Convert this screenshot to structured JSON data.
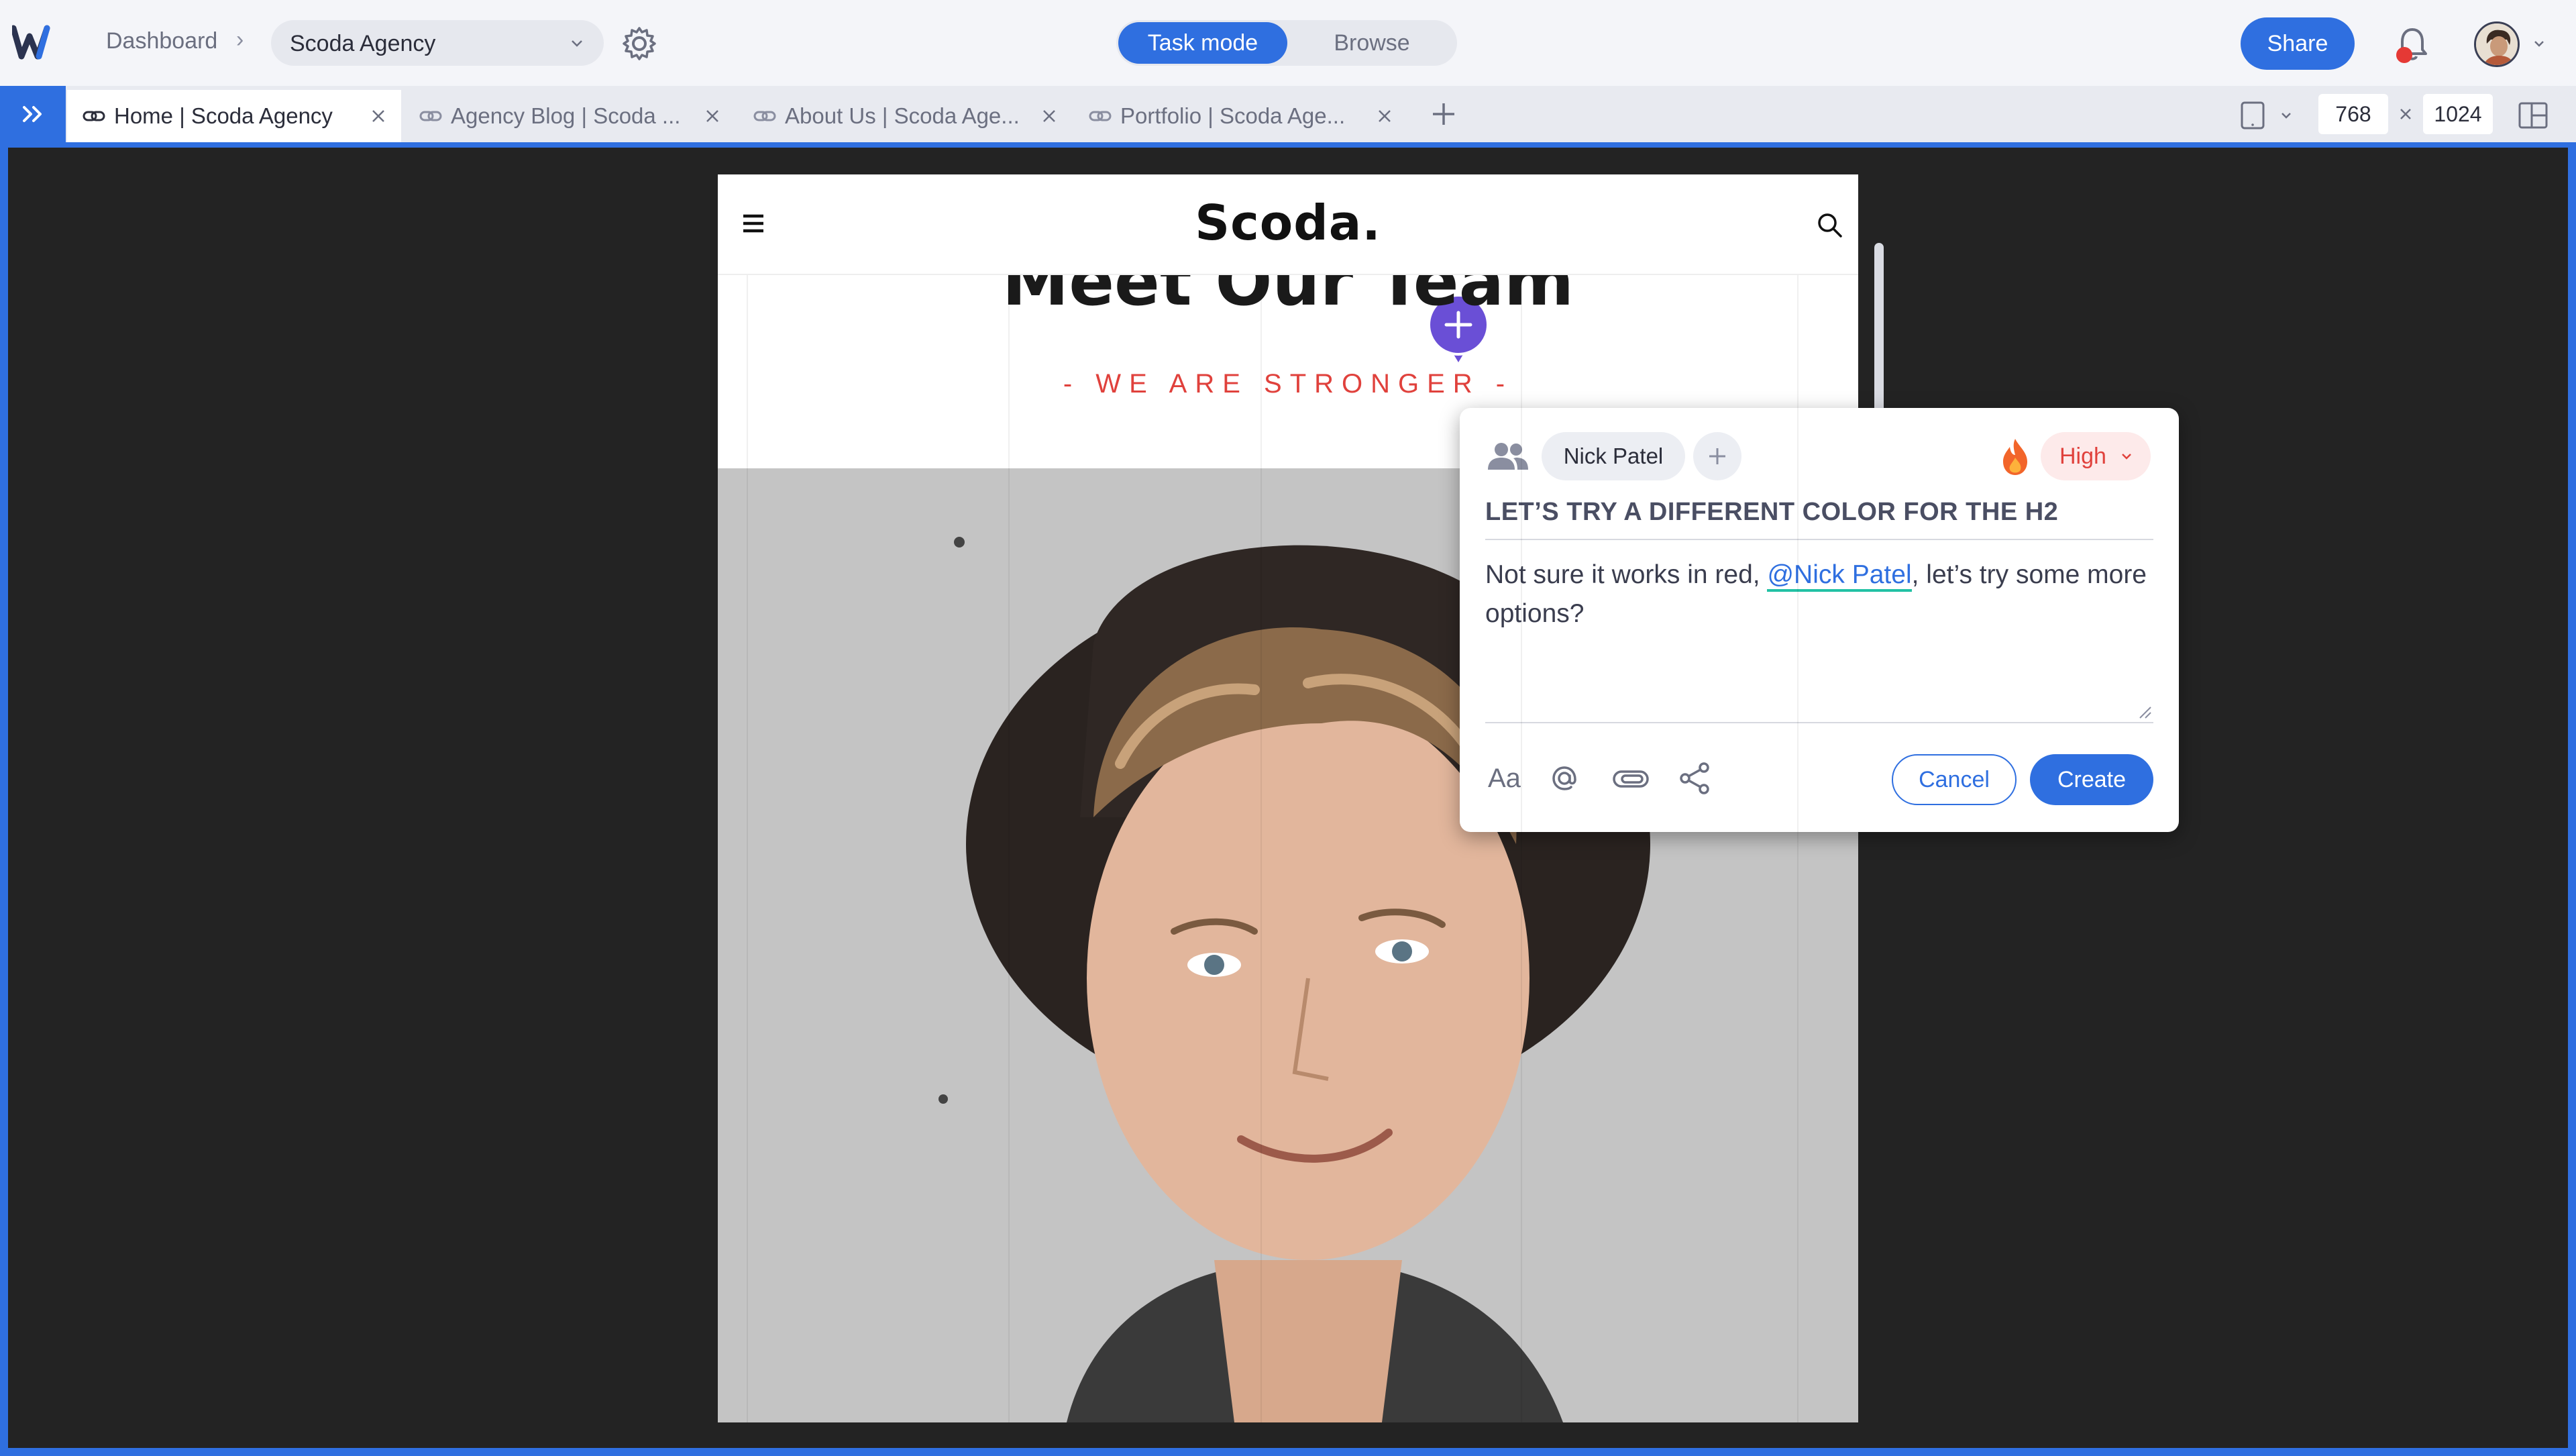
{
  "app": {
    "breadcrumb_root": "Dashboard",
    "project": "Scoda Agency",
    "modes": {
      "task": "Task mode",
      "browse": "Browse",
      "active": "task"
    },
    "share_label": "Share",
    "notification_dot": true
  },
  "tabs": [
    {
      "label": "Home | Scoda Agency",
      "active": true
    },
    {
      "label": "Agency Blog | Scoda ...",
      "active": false
    },
    {
      "label": "About Us | Scoda Age...",
      "active": false
    },
    {
      "label": "Portfolio | Scoda Age...",
      "active": false
    }
  ],
  "viewport": {
    "width": "768",
    "height": "1024"
  },
  "site": {
    "logo": "Scoda.",
    "hero_title": "Meet Our Team",
    "hero_subtitle": "- WE ARE STRONGER -"
  },
  "comment": {
    "assignee": "Nick Patel",
    "priority": "High",
    "title": "LET’S TRY A DIFFERENT COLOR FOR THE H2",
    "body_before": "Not sure it works in red, ",
    "mention": "@Nick Patel",
    "body_after": ", let’s try some more options?",
    "format_label": "Aa",
    "cancel_label": "Cancel",
    "create_label": "Create"
  },
  "icons": {
    "logo": "webflow-w-logo",
    "settings": "gear-icon",
    "notifications": "bell-icon",
    "tab_link": "link-icon",
    "tab_close": "close-icon",
    "add_tab": "plus-icon",
    "device": "tablet-icon",
    "layout": "panel-layout-icon",
    "site_menu": "hamburger-icon",
    "site_search": "search-icon",
    "pin": "add-comment-pin-icon",
    "people": "people-icon",
    "priority": "fire-icon",
    "mention": "at-icon",
    "attach": "paperclip-icon",
    "share": "share-icon"
  },
  "colors": {
    "accent": "#2f6fe0",
    "priority_high": "#e0413c",
    "pin": "#6a4fd6",
    "hero_subtitle": "#e0413c",
    "canvas_bg": "#232323"
  }
}
